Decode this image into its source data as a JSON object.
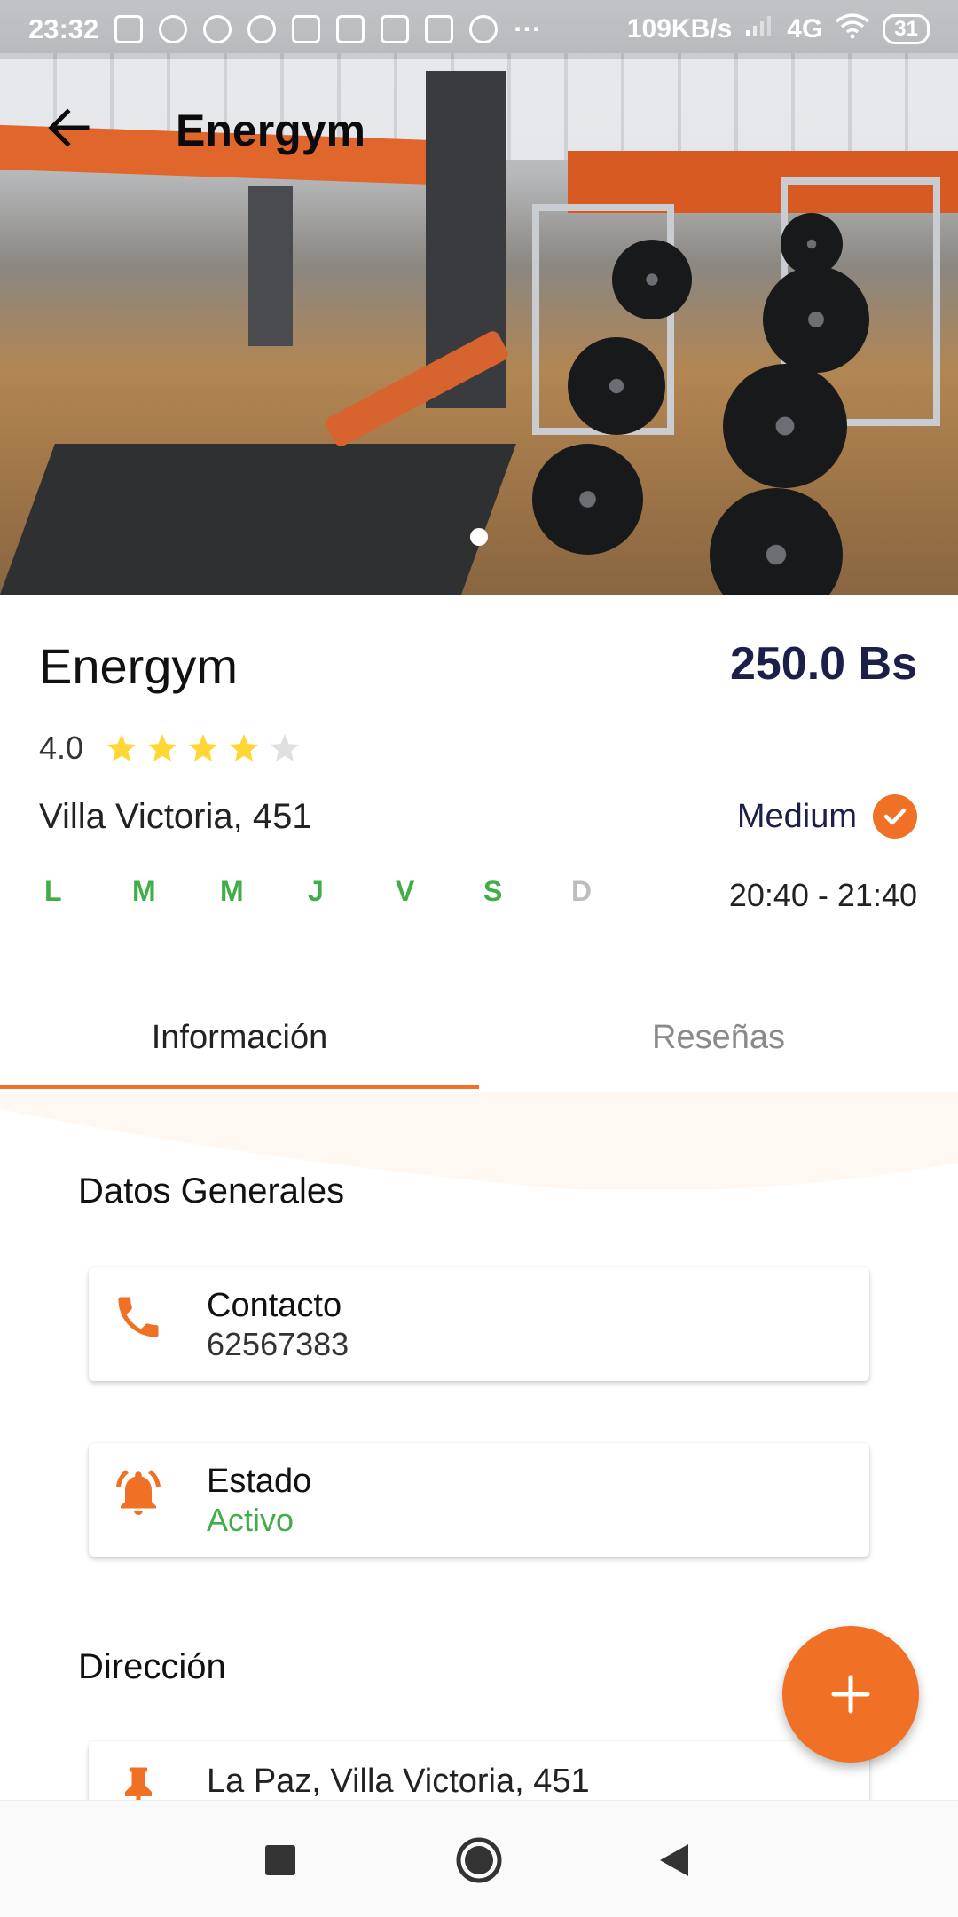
{
  "status_bar": {
    "time": "23:32",
    "speed": "109KB/s",
    "network": "4G",
    "battery": "31"
  },
  "app_bar": {
    "title": "Energym"
  },
  "hero": {
    "carousel_index": 1,
    "carousel_total": 1
  },
  "gym": {
    "name": "Energym",
    "price": "250.0 Bs",
    "rating": "4.0",
    "rating_value": 4,
    "rating_max": 5,
    "location": "Villa Victoria, 451",
    "level": "Medium",
    "days": [
      {
        "label": "L",
        "active": true
      },
      {
        "label": "M",
        "active": true
      },
      {
        "label": "M",
        "active": true
      },
      {
        "label": "J",
        "active": true
      },
      {
        "label": "V",
        "active": true
      },
      {
        "label": "S",
        "active": true
      },
      {
        "label": "D",
        "active": false
      }
    ],
    "hours": "20:40 - 21:40"
  },
  "tabs": [
    {
      "label": "Información",
      "selected": true
    },
    {
      "label": "Reseñas",
      "selected": false
    }
  ],
  "sections": {
    "general_title": "Datos Generales",
    "contact_title": "Contacto",
    "contact_value": "62567383",
    "status_title": "Estado",
    "status_value": "Activo",
    "address_title": "Dirección",
    "address_value": "La Paz, Villa Victoria, 451"
  },
  "colors": {
    "accent": "#f07025",
    "active_green": "#41ad49",
    "navy": "#1b1f4a",
    "star": "#fdd835"
  },
  "icons": {
    "contact": "phone-icon",
    "status": "bell-icon",
    "address": "pin-icon",
    "fab": "plus-icon"
  }
}
